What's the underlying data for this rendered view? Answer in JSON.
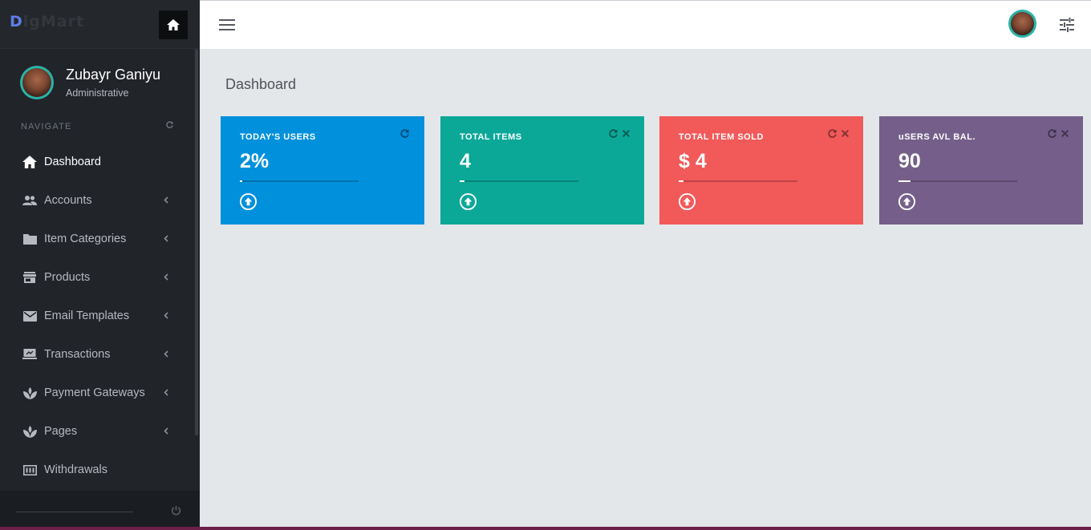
{
  "app": {
    "logo_first": "D",
    "logo_rest": "igMart"
  },
  "profile": {
    "name": "Zubayr Ganiyu",
    "role": "Administrative"
  },
  "sidebar": {
    "section_label": "NAVIGATE",
    "items": [
      {
        "label": "Dashboard",
        "icon": "home-icon",
        "active": true,
        "has_submenu": false
      },
      {
        "label": "Accounts",
        "icon": "people-icon",
        "active": false,
        "has_submenu": true
      },
      {
        "label": "Item Categories",
        "icon": "folder-icon",
        "active": false,
        "has_submenu": true
      },
      {
        "label": "Products",
        "icon": "store-icon",
        "active": false,
        "has_submenu": true
      },
      {
        "label": "Email Templates",
        "icon": "mail-icon",
        "active": false,
        "has_submenu": true
      },
      {
        "label": "Transactions",
        "icon": "laptop-icon",
        "active": false,
        "has_submenu": true
      },
      {
        "label": "Payment Gateways",
        "icon": "spa-icon",
        "active": false,
        "has_submenu": true
      },
      {
        "label": "Pages",
        "icon": "spa-icon",
        "active": false,
        "has_submenu": true
      },
      {
        "label": "Withdrawals",
        "icon": "money-icon",
        "active": false,
        "has_submenu": false
      }
    ]
  },
  "main": {
    "page_title": "Dashboard",
    "cards": [
      {
        "label": "TODAY'S USERS",
        "value": "2%",
        "color": "#0090dc",
        "progress": 0.02,
        "tools": [
          "refresh"
        ]
      },
      {
        "label": "TOTAL ITEMS",
        "value": "4",
        "color": "#0ba898",
        "progress": 0.04,
        "tools": [
          "refresh",
          "close"
        ]
      },
      {
        "label": "TOTAL ITEM SOLD",
        "value": "$ 4",
        "color": "#f25959",
        "progress": 0.04,
        "tools": [
          "refresh",
          "close"
        ]
      },
      {
        "label": "uSERS AVL BAL.",
        "value": "90",
        "color": "#755f8a",
        "progress": 0.1,
        "tools": [
          "refresh",
          "close"
        ]
      }
    ]
  }
}
